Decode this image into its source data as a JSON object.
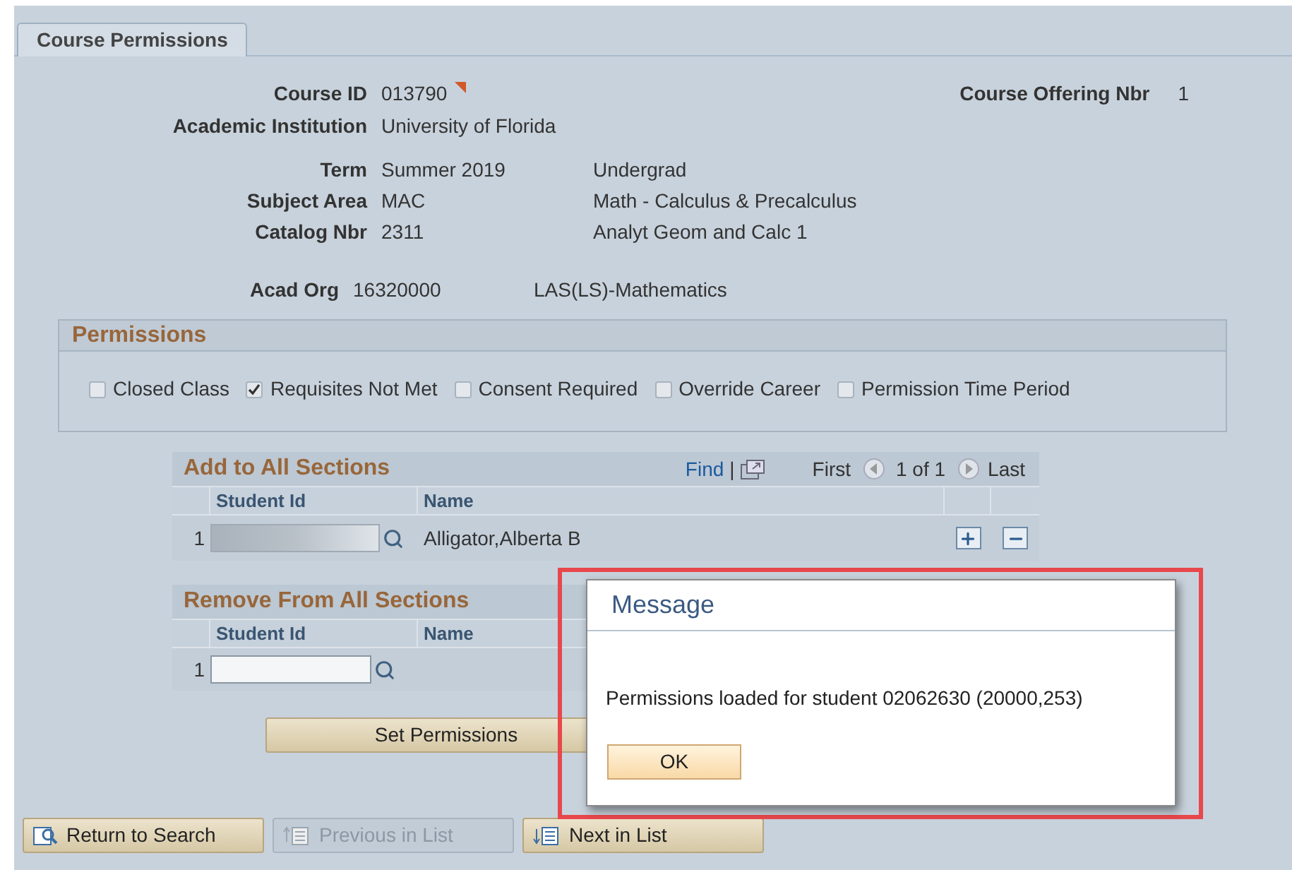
{
  "tab": {
    "label": "Course Permissions",
    "selected": true
  },
  "course": {
    "course_id": {
      "label": "Course ID",
      "value": "013790"
    },
    "institution": {
      "label": "Academic Institution",
      "value": "University of Florida"
    },
    "offering": {
      "label": "Course Offering Nbr",
      "value": "1"
    },
    "term": {
      "label": "Term",
      "value": "Summer 2019",
      "description": "Undergrad"
    },
    "subject": {
      "label": "Subject Area",
      "value": "MAC",
      "description": "Math - Calculus & Precalculus"
    },
    "catalog": {
      "label": "Catalog Nbr",
      "value": "2311",
      "description": "Analyt Geom and Calc 1"
    },
    "acad_org": {
      "label": "Acad Org",
      "value": "16320000",
      "description": "LAS(LS)-Mathematics"
    }
  },
  "permissions": {
    "title": "Permissions",
    "options": [
      {
        "label": "Closed Class",
        "checked": false
      },
      {
        "label": "Requisites Not Met",
        "checked": true
      },
      {
        "label": "Consent Required",
        "checked": false
      },
      {
        "label": "Override Career",
        "checked": false
      },
      {
        "label": "Permission Time Period",
        "checked": false
      }
    ]
  },
  "add_grid": {
    "title": "Add to All Sections",
    "find": "Find",
    "separator": "|",
    "first": "First",
    "count": "1 of 1",
    "last": "Last",
    "columns": [
      "Student Id",
      "Name"
    ],
    "rows": [
      {
        "number": "1",
        "name": "Alligator,Alberta B"
      }
    ]
  },
  "remove_grid": {
    "title": "Remove From All Sections",
    "columns": [
      "Student Id",
      "Name"
    ],
    "rows": [
      {
        "number": "1"
      }
    ]
  },
  "set_permissions_button": "Set Permissions",
  "dialog": {
    "title": "Message",
    "text": "Permissions loaded for student 02062630 (20000,253)",
    "button": "OK"
  },
  "footer_buttons": [
    {
      "kind": "search",
      "label": "Return to Search",
      "disabled": false
    },
    {
      "kind": "previous",
      "label": "Previous in List",
      "disabled": true
    },
    {
      "kind": "next",
      "label": "Next in List",
      "disabled": false
    }
  ]
}
